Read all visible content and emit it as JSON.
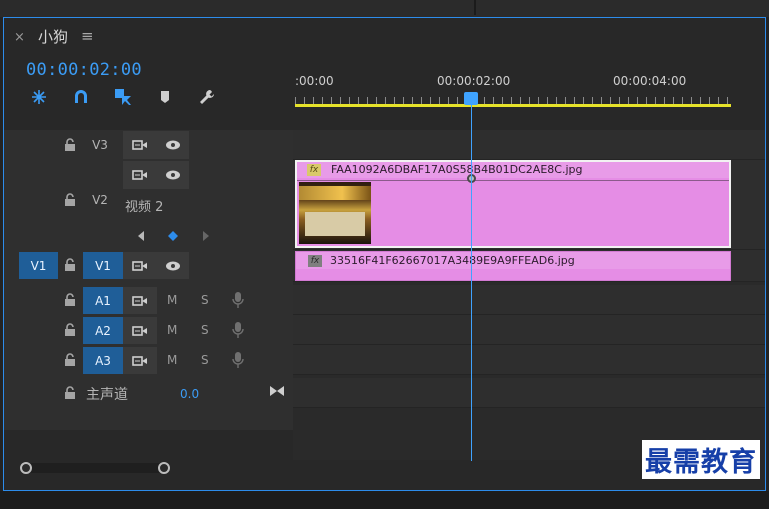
{
  "panel": {
    "title": "小狗",
    "timecode": "00:00:02:00"
  },
  "ruler": {
    "labels": [
      ":00:00",
      "00:00:02:00",
      "00:00:04:00"
    ]
  },
  "tracks": {
    "v3": {
      "name": "V3"
    },
    "v2": {
      "name": "V2",
      "display_name": "视频 2"
    },
    "v1": {
      "source": "V1",
      "name": "V1"
    },
    "a1": {
      "name": "A1",
      "mute": "M",
      "solo": "S"
    },
    "a2": {
      "name": "A2",
      "mute": "M",
      "solo": "S"
    },
    "a3": {
      "name": "A3",
      "mute": "M",
      "solo": "S"
    },
    "master": {
      "name": "主声道",
      "value": "0.0"
    }
  },
  "clips": {
    "v2_clip": {
      "name": "FAA1092A6DBAF17A0S58B4B01DC2AE8C.jpg",
      "fx": "fx"
    },
    "v1_clip": {
      "name": "33516F41F62667017A3489E9A9FFEAD6.jpg",
      "fx": "fx"
    }
  },
  "watermark": "最需教育",
  "colors": {
    "accent": "#3b9cf5",
    "clip": "#e58de5",
    "work_area": "#e6e22a",
    "track_target": "#1f5e98"
  },
  "icons": [
    "close-icon",
    "panel-menu-icon",
    "snap-icon",
    "magnet-icon",
    "linked-selection-icon",
    "marker-icon",
    "wrench-icon",
    "lock-icon",
    "film-icon",
    "eye-icon",
    "mic-icon",
    "keyframe-prev-icon",
    "keyframe-add-icon",
    "keyframe-next-icon",
    "bowtie-icon"
  ]
}
